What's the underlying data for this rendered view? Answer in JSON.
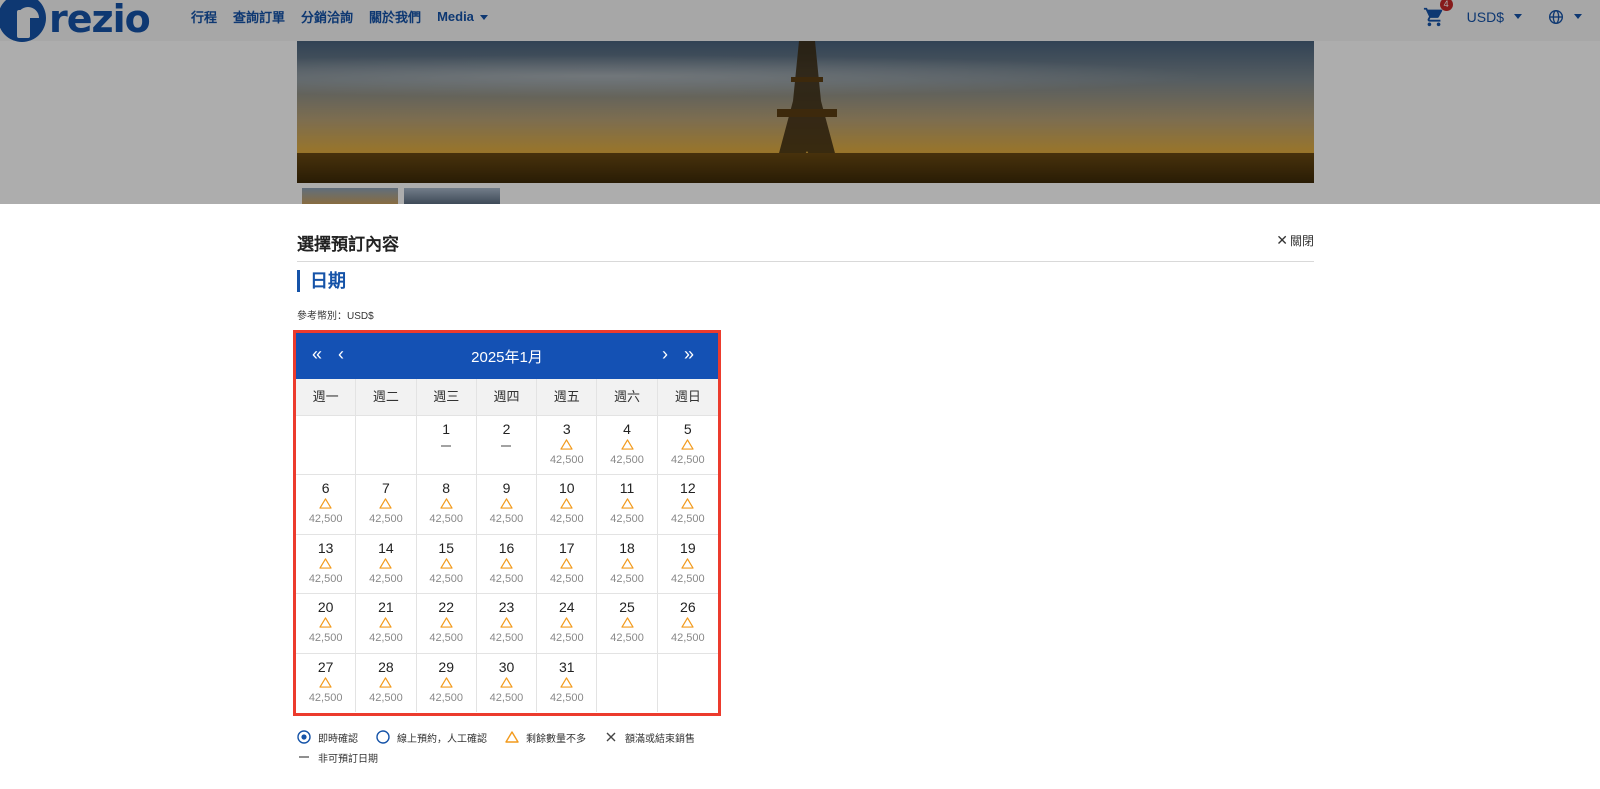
{
  "topbar": {
    "logo_text": "rezio",
    "nav": [
      "行程",
      "查詢訂單",
      "分銷洽詢",
      "關於我們",
      "Media"
    ],
    "cart_count": "4",
    "currency": "USD$"
  },
  "modal": {
    "title": "選擇預訂內容",
    "close_label": "關閉",
    "section_title": "日期",
    "currency_note": "參考幣別：USD$"
  },
  "calendar": {
    "month_label": "2025年1月",
    "prev_year": "«",
    "prev_month": "‹",
    "next_month": "›",
    "next_year": "»",
    "weekdays": [
      "週一",
      "週二",
      "週三",
      "週四",
      "週五",
      "週六",
      "週日"
    ],
    "weeks": [
      [
        {
          "day": "",
          "status": "",
          "price": ""
        },
        {
          "day": "",
          "status": "",
          "price": ""
        },
        {
          "day": "1",
          "status": "unavailable",
          "price": ""
        },
        {
          "day": "2",
          "status": "unavailable",
          "price": ""
        },
        {
          "day": "3",
          "status": "limited",
          "price": "42,500"
        },
        {
          "day": "4",
          "status": "limited",
          "price": "42,500"
        },
        {
          "day": "5",
          "status": "limited",
          "price": "42,500"
        }
      ],
      [
        {
          "day": "6",
          "status": "limited",
          "price": "42,500"
        },
        {
          "day": "7",
          "status": "limited",
          "price": "42,500"
        },
        {
          "day": "8",
          "status": "limited",
          "price": "42,500"
        },
        {
          "day": "9",
          "status": "limited",
          "price": "42,500"
        },
        {
          "day": "10",
          "status": "limited",
          "price": "42,500"
        },
        {
          "day": "11",
          "status": "limited",
          "price": "42,500"
        },
        {
          "day": "12",
          "status": "limited",
          "price": "42,500"
        }
      ],
      [
        {
          "day": "13",
          "status": "limited",
          "price": "42,500"
        },
        {
          "day": "14",
          "status": "limited",
          "price": "42,500"
        },
        {
          "day": "15",
          "status": "limited",
          "price": "42,500"
        },
        {
          "day": "16",
          "status": "limited",
          "price": "42,500"
        },
        {
          "day": "17",
          "status": "limited",
          "price": "42,500"
        },
        {
          "day": "18",
          "status": "limited",
          "price": "42,500"
        },
        {
          "day": "19",
          "status": "limited",
          "price": "42,500"
        }
      ],
      [
        {
          "day": "20",
          "status": "limited",
          "price": "42,500"
        },
        {
          "day": "21",
          "status": "limited",
          "price": "42,500"
        },
        {
          "day": "22",
          "status": "limited",
          "price": "42,500"
        },
        {
          "day": "23",
          "status": "limited",
          "price": "42,500"
        },
        {
          "day": "24",
          "status": "limited",
          "price": "42,500"
        },
        {
          "day": "25",
          "status": "limited",
          "price": "42,500"
        },
        {
          "day": "26",
          "status": "limited",
          "price": "42,500"
        }
      ],
      [
        {
          "day": "27",
          "status": "limited",
          "price": "42,500"
        },
        {
          "day": "28",
          "status": "limited",
          "price": "42,500"
        },
        {
          "day": "29",
          "status": "limited",
          "price": "42,500"
        },
        {
          "day": "30",
          "status": "limited",
          "price": "42,500"
        },
        {
          "day": "31",
          "status": "limited",
          "price": "42,500"
        },
        {
          "day": "",
          "status": "",
          "price": ""
        },
        {
          "day": "",
          "status": "",
          "price": ""
        }
      ]
    ]
  },
  "legend": {
    "instant": "即時確認",
    "manual": "線上預約，人工確認",
    "limited": "剩餘數量不多",
    "soldout": "額滿或結束銷售",
    "unavailable": "非可預訂日期"
  },
  "colors": {
    "brand": "#1553a8",
    "calendar_header": "#1451b4",
    "highlight_border": "#ec3b2d",
    "limited_icon": "#f29a1c"
  },
  "icons": {
    "cart": "cart-icon",
    "globe": "globe-icon",
    "close": "close-icon",
    "limited": "triangle-warning-icon",
    "soldout": "cross-icon",
    "unavailable": "dash-icon",
    "instant": "radio-checked-icon",
    "manual": "radio-empty-icon"
  }
}
